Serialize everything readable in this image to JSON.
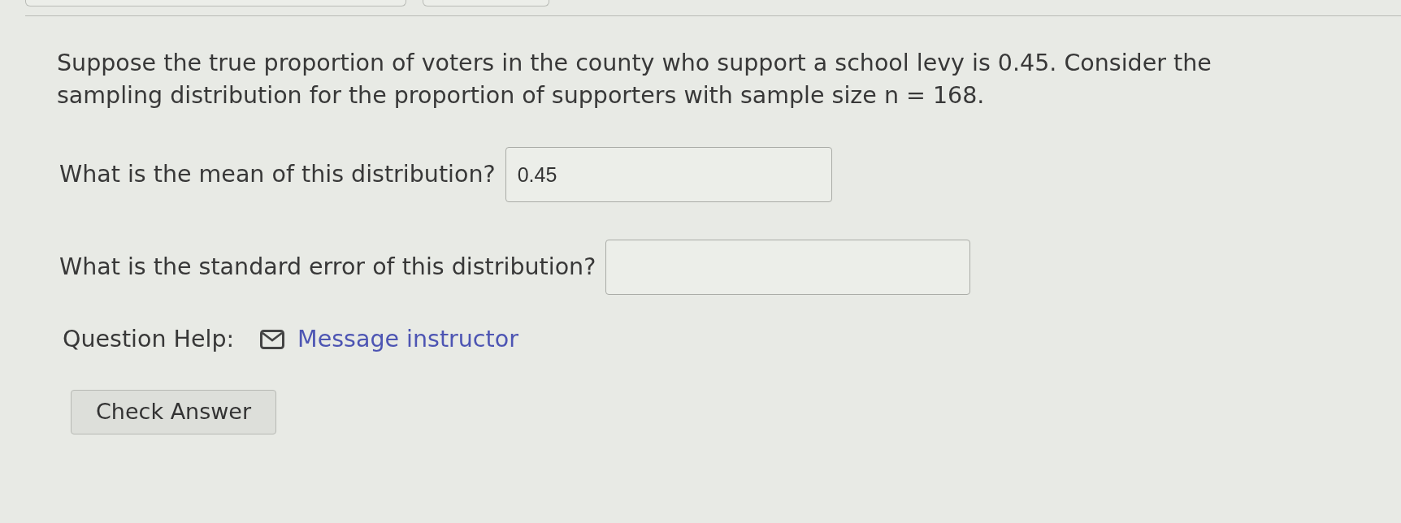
{
  "question": {
    "text": "Suppose the true proportion of voters in the county who support a school levy is 0.45. Consider the sampling distribution for the proportion of supporters with sample size n = 168."
  },
  "parts": [
    {
      "label": "What is the mean of this distribution?",
      "value": "0.45"
    },
    {
      "label": "What is the standard error of this distribution?"
    }
  ],
  "help": {
    "label": "Question Help:",
    "link": "Message instructor"
  },
  "buttons": [
    {
      "label": "Check Answer"
    }
  ]
}
